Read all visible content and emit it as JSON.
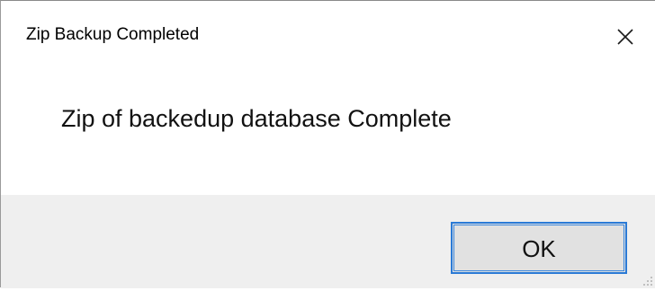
{
  "window": {
    "title": "Zip Backup Completed",
    "close_icon": "close-icon"
  },
  "message": {
    "text": "Zip of backedup database Complete"
  },
  "buttons": {
    "ok_label": "OK"
  },
  "colors": {
    "button_focus_border": "#2a7ad6",
    "footer_background": "#efefef",
    "button_background": "#e1e1e1"
  }
}
